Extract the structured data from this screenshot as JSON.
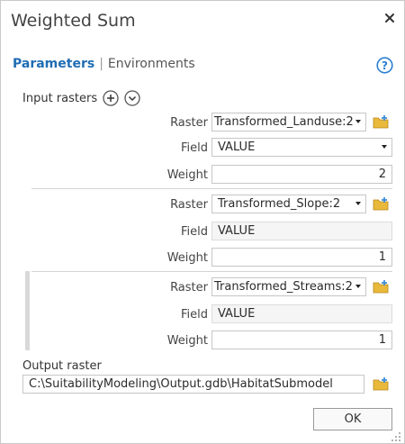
{
  "dialog": {
    "title": "Weighted Sum",
    "close_icon": "close-icon",
    "help_icon": "help-icon"
  },
  "tabs": {
    "parameters": "Parameters",
    "separator": "|",
    "environments": "Environments"
  },
  "input_rasters": {
    "label": "Input rasters",
    "add_icon": "add-icon",
    "expand_icon": "expand-icon",
    "raster_label": "Raster",
    "field_label": "Field",
    "weight_label": "Weight",
    "items": [
      {
        "raster": "Transformed_Landuse:2",
        "field": "VALUE",
        "field_dropdown": true,
        "weight": "2"
      },
      {
        "raster": "Transformed_Slope:2",
        "field": "VALUE",
        "field_dropdown": false,
        "weight": "1"
      },
      {
        "raster": "Transformed_Streams:2",
        "field": "VALUE",
        "field_dropdown": false,
        "weight": "1"
      }
    ]
  },
  "output_raster": {
    "label": "Output raster",
    "value": "C:\\SuitabilityModeling\\Output.gdb\\HabitatSubmodel"
  },
  "buttons": {
    "ok": "OK"
  },
  "colors": {
    "accent": "#1f6db3",
    "folder": "#e9b93b",
    "plus": "#3d8ed8"
  }
}
